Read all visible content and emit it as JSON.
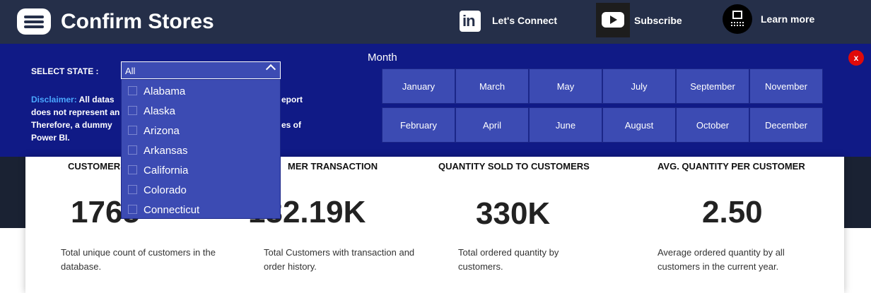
{
  "header": {
    "title": "Confirm Stores",
    "links": {
      "connect": "Let's Connect",
      "subscribe": "Subscribe",
      "learn": "Learn more"
    },
    "bg_color": "#252f49"
  },
  "filters": {
    "state_label": "SELECT STATE :",
    "state_value": "All",
    "state_options": [
      "Alabama",
      "Alaska",
      "Arizona",
      "Arkansas",
      "California",
      "Colorado",
      "Connecticut"
    ],
    "month_title": "Month",
    "months": [
      "January",
      "March",
      "May",
      "July",
      "September",
      "November",
      "February",
      "April",
      "June",
      "August",
      "October",
      "December"
    ],
    "close_label": "x",
    "disclaimer_lead": "Disclaimer:",
    "disclaimer_lines": [
      "All datas",
      "does not represent an",
      "Therefore, a dummy",
      "Power BI."
    ],
    "disclaimer_right_lines": [
      "eport",
      "",
      "es of"
    ],
    "panel_color": "#101a86",
    "accent_color": "#3c4bb3"
  },
  "kpis": [
    {
      "title": "CUSTOMERS",
      "value": "1765",
      "desc": "Total unique count of customers in the database."
    },
    {
      "title": "MER TRANSACTION",
      "value": "132.19K",
      "desc": "Total Customers with transaction and order history."
    },
    {
      "title": "QUANTITY SOLD TO CUSTOMERS",
      "value": "330K",
      "desc": "Total ordered quantity by customers."
    },
    {
      "title": "AVG. QUANTITY PER CUSTOMER",
      "value": "2.50",
      "desc": "Average ordered quantity by all customers in the current year."
    }
  ]
}
